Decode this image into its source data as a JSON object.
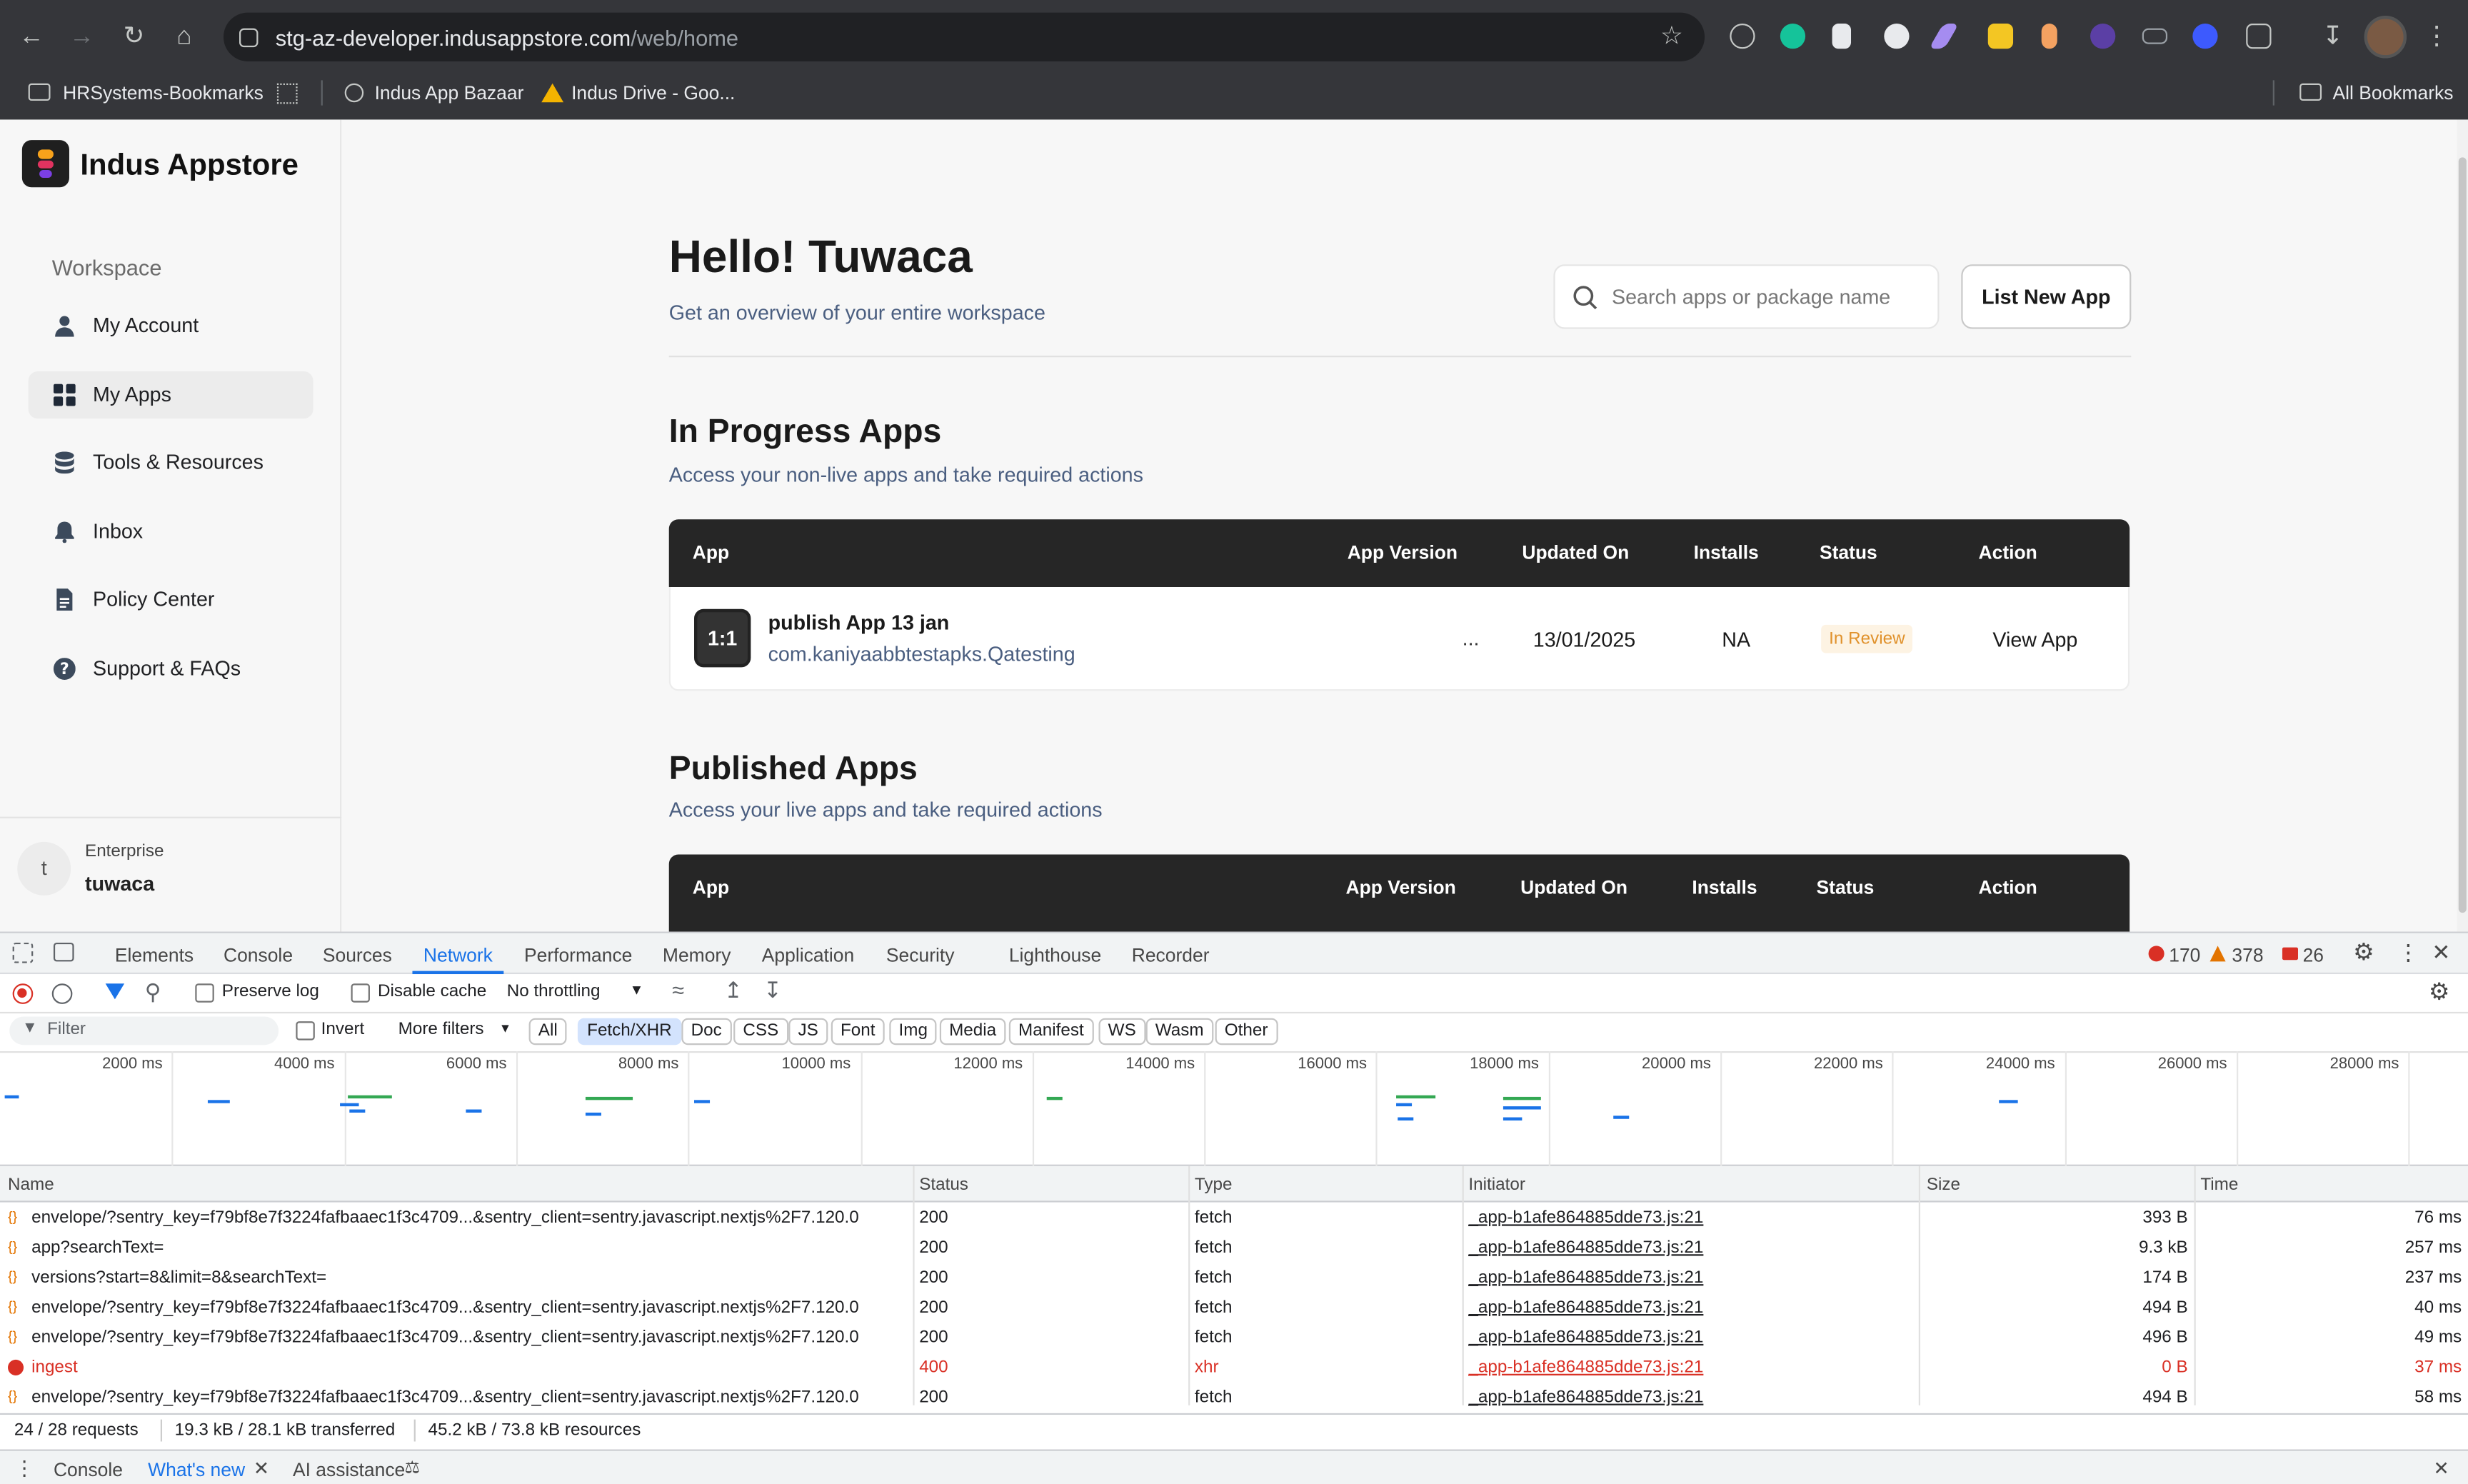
{
  "browser": {
    "url_host": "stg-az-developer.indusappstore.com",
    "url_path": "/web/home",
    "bookmarks": [
      {
        "label": "HRSystems-Bookmarks"
      },
      {
        "label": "Indus App Bazaar"
      },
      {
        "label": "Indus Drive - Goo..."
      }
    ],
    "all_bookmarks": "All Bookmarks"
  },
  "app": {
    "logo_text": "Indus Appstore",
    "workspace_label": "Workspace",
    "nav": [
      {
        "label": "My Account",
        "icon": "person-icon"
      },
      {
        "label": "My Apps",
        "icon": "grid-icon"
      },
      {
        "label": "Tools & Resources",
        "icon": "database-icon"
      },
      {
        "label": "Inbox",
        "icon": "bell-icon"
      },
      {
        "label": "Policy Center",
        "icon": "document-icon"
      },
      {
        "label": "Support & FAQs",
        "icon": "help-icon"
      }
    ],
    "account": {
      "avatar_letter": "t",
      "type": "Enterprise",
      "name": "tuwaca"
    }
  },
  "main": {
    "greeting": "Hello! Tuwaca",
    "subtitle": "Get an overview of your entire workspace",
    "search_placeholder": "Search apps or package name",
    "list_new_app": "List New App",
    "in_progress": {
      "title": "In Progress Apps",
      "subtitle": "Access your non-live apps and take required actions",
      "columns": [
        "App",
        "App Version",
        "Updated On",
        "Installs",
        "Status",
        "Action"
      ],
      "row": {
        "icon_text": "1:1",
        "name": "publish App 13 jan",
        "package": "com.kaniyaabbtestapks.Qatesting",
        "version": "...",
        "updated": "13/01/2025",
        "installs": "NA",
        "status": "In Review",
        "action": "View App"
      }
    },
    "published": {
      "title": "Published Apps",
      "subtitle": "Access your live apps and take required actions",
      "columns": [
        "App",
        "App Version",
        "Updated On",
        "Installs",
        "Status",
        "Action"
      ]
    }
  },
  "devtools": {
    "tabs": [
      "Elements",
      "Console",
      "Sources",
      "Network",
      "Performance",
      "Memory",
      "Application",
      "Security",
      "Lighthouse",
      "Recorder"
    ],
    "errors": "170",
    "warnings": "378",
    "messages": "26",
    "preserve_log": "Preserve log",
    "disable_cache": "Disable cache",
    "throttling": "No throttling",
    "filter_placeholder": "Filter",
    "invert": "Invert",
    "more_filters": "More filters",
    "type_filters": [
      "All",
      "Fetch/XHR",
      "Doc",
      "CSS",
      "JS",
      "Font",
      "Img",
      "Media",
      "Manifest",
      "WS",
      "Wasm",
      "Other"
    ],
    "active_filter": "Fetch/XHR",
    "timeline_ticks": [
      "2000 ms",
      "4000 ms",
      "6000 ms",
      "8000 ms",
      "10000 ms",
      "12000 ms",
      "14000 ms",
      "16000 ms",
      "18000 ms",
      "20000 ms",
      "22000 ms",
      "24000 ms",
      "26000 ms",
      "28000 ms"
    ],
    "columns": [
      "Name",
      "Status",
      "Type",
      "Initiator",
      "Size",
      "Time"
    ],
    "requests": [
      {
        "name": "envelope/?sentry_key=f79bf8e7f3224fafbaaec1f3c4709...&sentry_client=sentry.javascript.nextjs%2F7.120.0",
        "status": "200",
        "type": "fetch",
        "initiator": "_app-b1afe864885dde73.js:21",
        "size": "393 B",
        "time": "76 ms",
        "error": false
      },
      {
        "name": "app?searchText=",
        "status": "200",
        "type": "fetch",
        "initiator": "_app-b1afe864885dde73.js:21",
        "size": "9.3 kB",
        "time": "257 ms",
        "error": false
      },
      {
        "name": "versions?start=8&limit=8&searchText=",
        "status": "200",
        "type": "fetch",
        "initiator": "_app-b1afe864885dde73.js:21",
        "size": "174 B",
        "time": "237 ms",
        "error": false
      },
      {
        "name": "envelope/?sentry_key=f79bf8e7f3224fafbaaec1f3c4709...&sentry_client=sentry.javascript.nextjs%2F7.120.0",
        "status": "200",
        "type": "fetch",
        "initiator": "_app-b1afe864885dde73.js:21",
        "size": "494 B",
        "time": "40 ms",
        "error": false
      },
      {
        "name": "envelope/?sentry_key=f79bf8e7f3224fafbaaec1f3c4709...&sentry_client=sentry.javascript.nextjs%2F7.120.0",
        "status": "200",
        "type": "fetch",
        "initiator": "_app-b1afe864885dde73.js:21",
        "size": "496 B",
        "time": "49 ms",
        "error": false
      },
      {
        "name": "ingest",
        "status": "400",
        "type": "xhr",
        "initiator": "_app-b1afe864885dde73.js:21",
        "size": "0 B",
        "time": "37 ms",
        "error": true
      },
      {
        "name": "envelope/?sentry_key=f79bf8e7f3224fafbaaec1f3c4709...&sentry_client=sentry.javascript.nextjs%2F7.120.0",
        "status": "200",
        "type": "fetch",
        "initiator": "_app-b1afe864885dde73.js:21",
        "size": "494 B",
        "time": "58 ms",
        "error": false
      }
    ],
    "summary_requests": "24 / 28 requests",
    "summary_transferred": "19.3 kB / 28.1 kB transferred",
    "summary_resources": "45.2 kB / 73.8 kB resources",
    "drawer_tabs": [
      "Console",
      "What's new",
      "AI assistance"
    ]
  },
  "colors": {
    "error": "#d93025",
    "status_review_bg": "#fdf3e3",
    "status_review_fg": "#e0912b",
    "active_tab": "#1a73e8"
  }
}
